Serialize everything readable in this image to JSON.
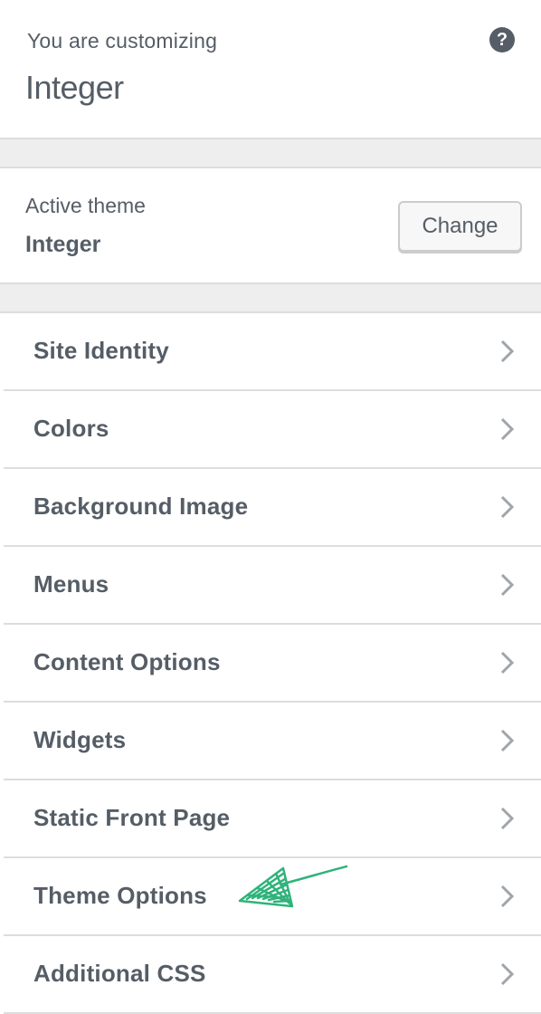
{
  "header": {
    "customizing_label": "You are customizing",
    "site_title": "Integer",
    "help_glyph": "?",
    "help_icon": "help-circle-icon"
  },
  "theme": {
    "label": "Active theme",
    "name": "Integer",
    "change_button": "Change"
  },
  "sections": [
    {
      "label": "Site Identity",
      "icon": "chevron-right-icon"
    },
    {
      "label": "Colors",
      "icon": "chevron-right-icon"
    },
    {
      "label": "Background Image",
      "icon": "chevron-right-icon"
    },
    {
      "label": "Menus",
      "icon": "chevron-right-icon"
    },
    {
      "label": "Content Options",
      "icon": "chevron-right-icon"
    },
    {
      "label": "Widgets",
      "icon": "chevron-right-icon"
    },
    {
      "label": "Static Front Page",
      "icon": "chevron-right-icon"
    },
    {
      "label": "Theme Options",
      "icon": "chevron-right-icon"
    },
    {
      "label": "Additional CSS",
      "icon": "chevron-right-icon"
    }
  ],
  "annotation": {
    "icon": "hand-drawn-arrow-icon",
    "color": "#2fb37a"
  },
  "colors": {
    "text": "#555d66",
    "divider": "#dddddd",
    "gap_background": "#eeeeee",
    "chevron": "#a0a5aa"
  }
}
